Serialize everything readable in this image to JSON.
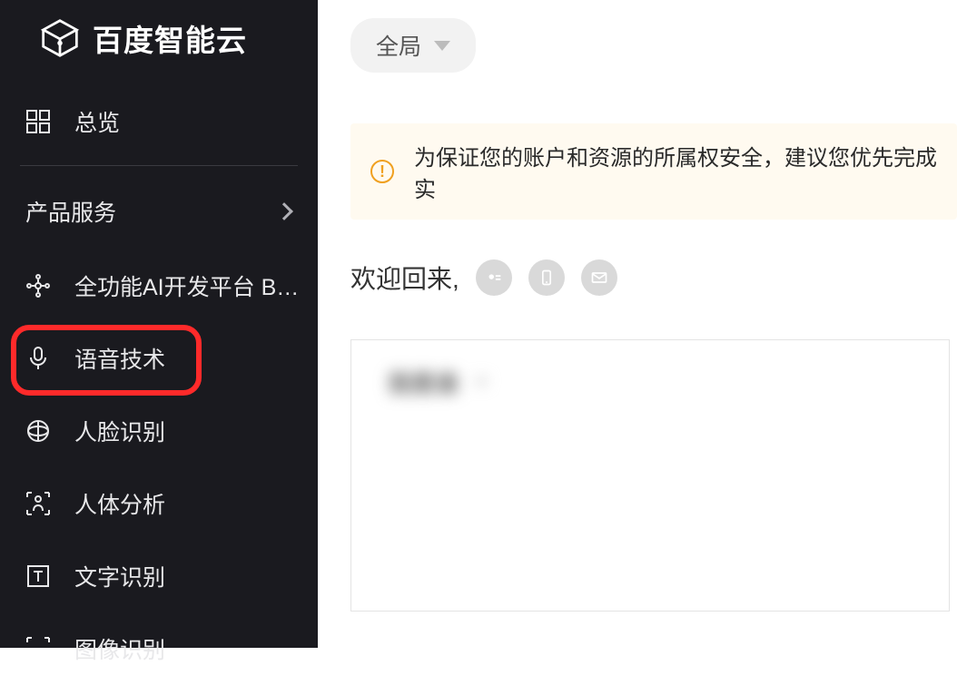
{
  "brand": {
    "name": "百度智能云"
  },
  "sidebar": {
    "overview": "总览",
    "section": "产品服务",
    "items": [
      {
        "label": "全功能AI开发平台 B…",
        "icon": "ai-platform-icon"
      },
      {
        "label": "语音技术",
        "icon": "mic-icon",
        "highlighted": true
      },
      {
        "label": "人脸识别",
        "icon": "face-icon"
      },
      {
        "label": "人体分析",
        "icon": "body-icon"
      },
      {
        "label": "文字识别",
        "icon": "text-icon"
      },
      {
        "label": "图像识别",
        "icon": "image-icon"
      }
    ]
  },
  "header": {
    "scope": "全局"
  },
  "alert": {
    "text": "为保证您的账户和资源的所属权安全，建议您优先完成实"
  },
  "welcome": {
    "greeting": "欢迎回来,"
  },
  "card": {
    "blurred_label": "我是谁"
  }
}
